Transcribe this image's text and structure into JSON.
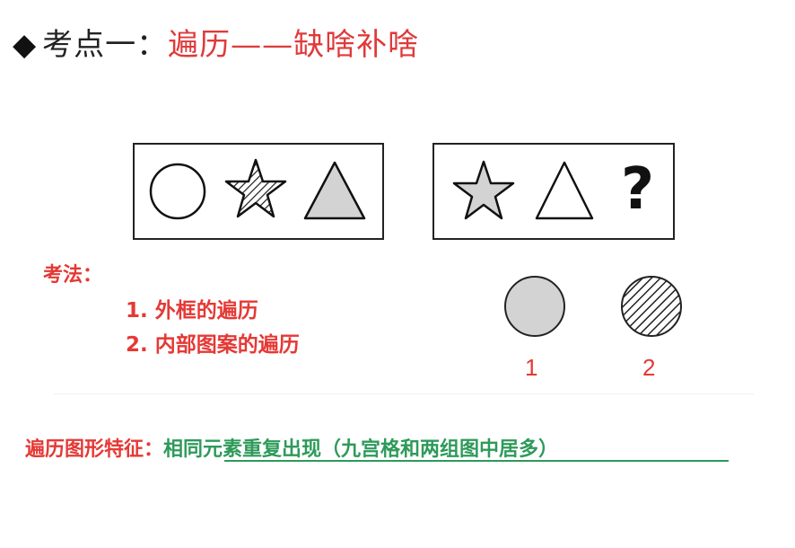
{
  "title": {
    "bullet": "◆",
    "lead": "考点一：",
    "topic": "遍历——缺啥补啥"
  },
  "question": {
    "mark": "?"
  },
  "methods": {
    "title": "考法：",
    "items": [
      "1. 外框的遍历",
      "2. 内部图案的遍历"
    ]
  },
  "options": {
    "labels": [
      "1",
      "2"
    ]
  },
  "feature": {
    "label": "遍历图形特征：",
    "value": "相同元素重复出现（九宫格和两组图中居多）"
  },
  "colors": {
    "accent_red": "#e53935",
    "accent_green": "#2e9a5a",
    "shape_fill_gray": "#d3d3d3"
  },
  "icons": [
    "diamond-bullet-icon",
    "circle-icon",
    "striped-star-icon",
    "gray-triangle-icon",
    "gray-star-icon",
    "triangle-icon",
    "gray-circle-icon",
    "striped-circle-icon"
  ]
}
